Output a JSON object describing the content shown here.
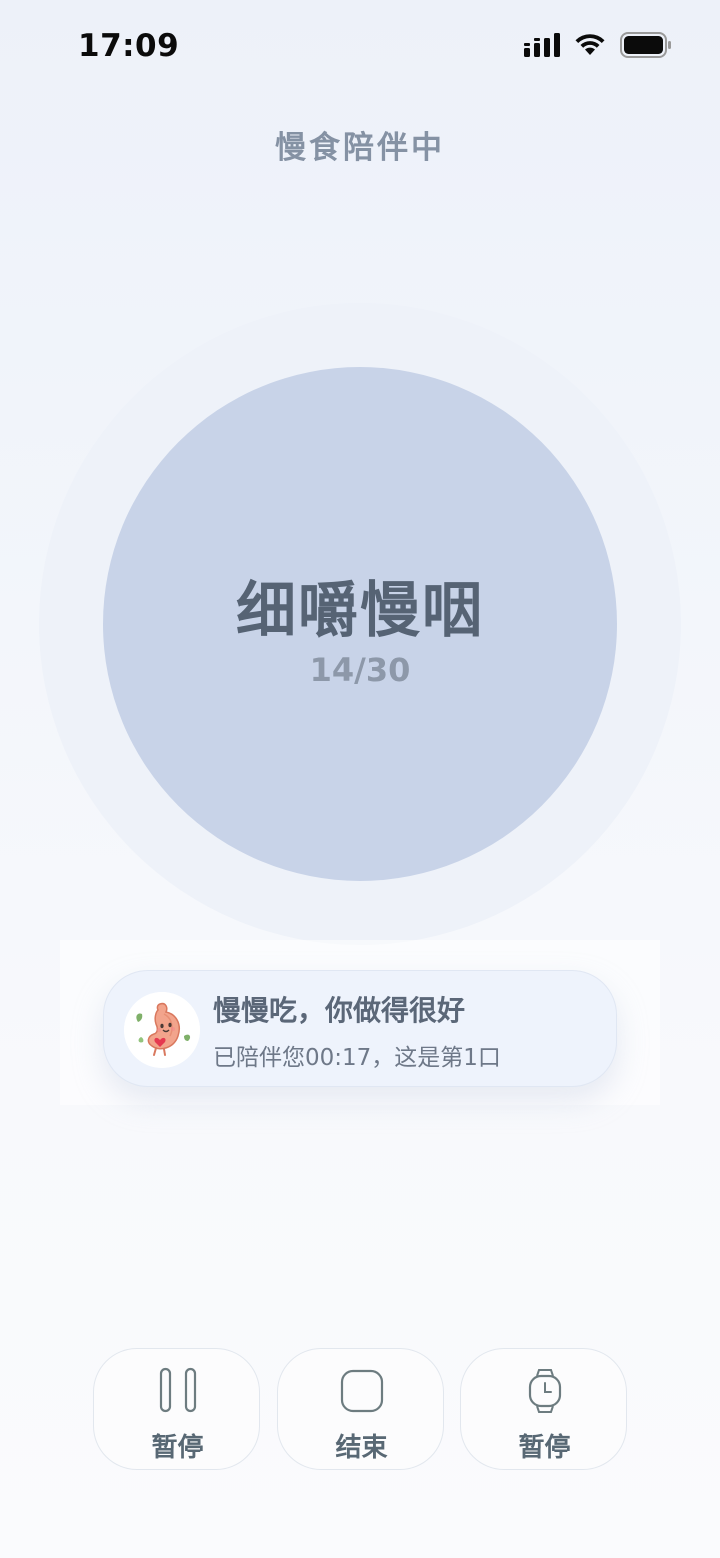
{
  "status_bar": {
    "time": "17:09"
  },
  "header": {
    "title": "慢食陪伴中"
  },
  "circle": {
    "title": "细嚼慢咽",
    "count": "14/30"
  },
  "message": {
    "title": "慢慢吃，你做得很好",
    "subtitle": "已陪伴您00:17，这是第1口"
  },
  "controls": [
    {
      "label": "暂停",
      "icon": "pause-icon"
    },
    {
      "label": "结束",
      "icon": "stop-icon"
    },
    {
      "label": "暂停",
      "icon": "watch-icon"
    }
  ],
  "colors": {
    "inner_circle": "#c8d3e8",
    "outer_ring": "#eef2f9",
    "card_bg": "#eef3fc",
    "control_text": "#586874"
  }
}
